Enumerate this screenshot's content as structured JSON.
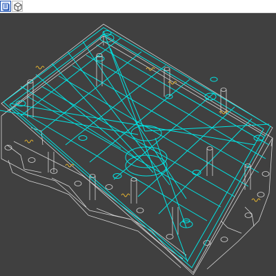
{
  "colors": {
    "viewport_background": "#404040",
    "wire_primary": "#00e5e5",
    "wire_outline": "#d8d8d8",
    "wire_accent": "#e0b030",
    "toolbar_background": "#ffffff"
  },
  "toolbar": {
    "buttons": [
      {
        "icon": "view-icon",
        "selected": true
      },
      {
        "icon": "isometric-cube-icon",
        "selected": false
      }
    ]
  },
  "viewport": {
    "content": "wireframe-mold-base-3d-model"
  }
}
